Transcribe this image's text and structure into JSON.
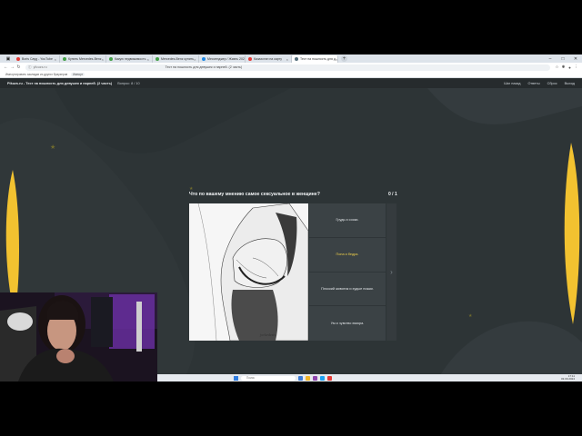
{
  "browser": {
    "tabs": [
      {
        "label": "Boris Cayg - YouTube",
        "color": "#e53935"
      },
      {
        "label": "Купить Mercedes-Benz",
        "color": "#43a047"
      },
      {
        "label": "Какую недвижимость",
        "color": "#43a047"
      },
      {
        "label": "Mercedes-Benz купить",
        "color": "#43a047"
      },
      {
        "label": "Мессенджер / Жизнь 2024",
        "color": "#1e88e5"
      },
      {
        "label": "Казахстан на карту",
        "color": "#e53935"
      },
      {
        "label": "Тест на пошлость для д",
        "color": "#546e7a",
        "active": true
      }
    ],
    "url": "yllcuzs.ru",
    "page_title": "Тест на пошлость для девушек и парней. (2 часть)",
    "bookmarks_text": "Импортировать закладки из других браузеров",
    "bookmarks_button": "Импорт",
    "ext_icons": [
      "star-icon",
      "puzzle-icon",
      "profile-icon",
      "menu-icon"
    ]
  },
  "site": {
    "title": "Pikuzs.ru - Тест на пошлость для девушек и парней. (2 часть)",
    "question_counter": "Вопрос: 8 / 10",
    "nav": [
      "Шаг назад",
      "Ответы",
      "Сброс",
      "Выход"
    ]
  },
  "quiz": {
    "question": "Что по вашему мнению самое сексуальное в женщине?",
    "score": "0 / 1",
    "answers": [
      "Грудь и соски.",
      "Попа и бедра.",
      "Плоский животик и худые ножки.",
      "Ум и чувство юмора."
    ],
    "hovered_index": 1,
    "image_signature": "jovlzrdestv"
  },
  "taskbar": {
    "search_placeholder": "Поиск",
    "time": "17:11",
    "date": "03.09.2024"
  },
  "colors": {
    "accent_yellow": "#f2c230",
    "background": "#2d3436"
  }
}
